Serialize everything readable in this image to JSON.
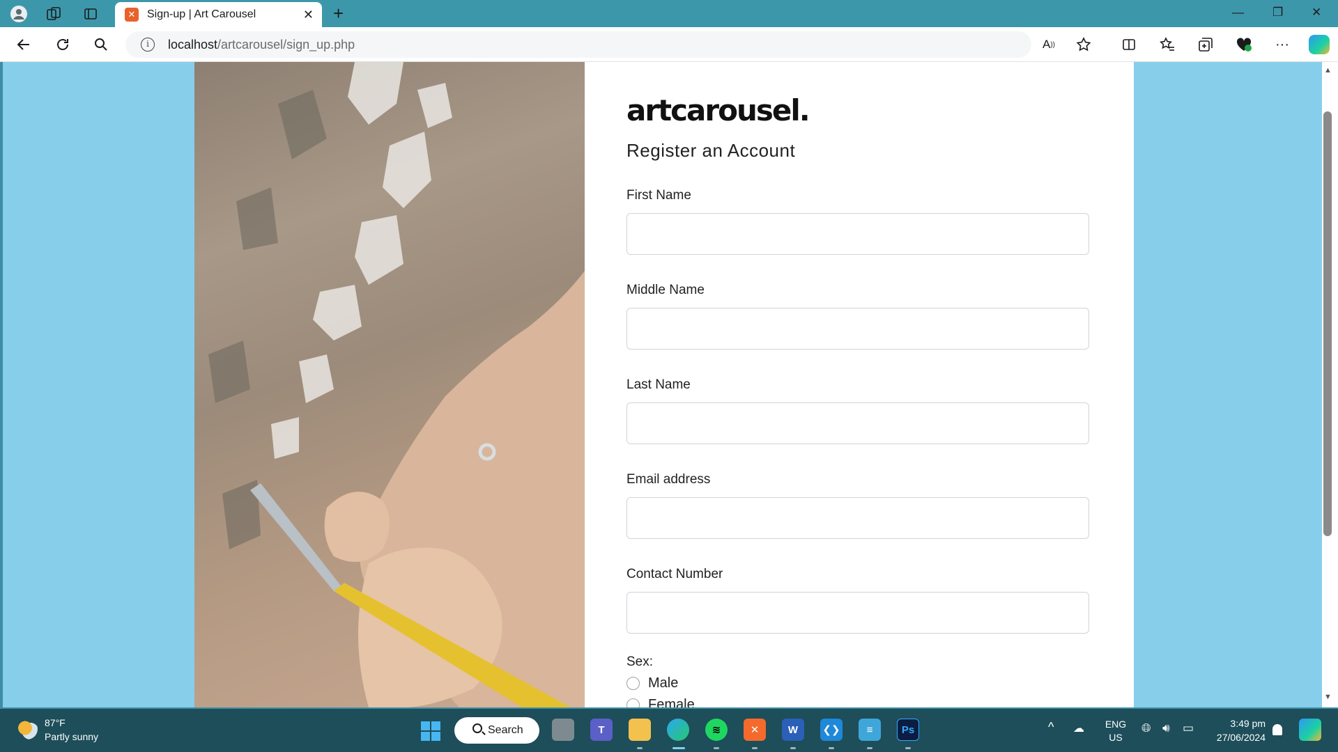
{
  "browser": {
    "tab_title": "Sign-up | Art Carousel",
    "tab_favicon": "xampp-icon",
    "url_host": "localhost",
    "url_path": "/artcarousel/sign_up.php"
  },
  "page": {
    "logo_text": "artcarousel.",
    "heading": "Register an Account",
    "fields": [
      {
        "label": "First Name",
        "value": ""
      },
      {
        "label": "Middle Name",
        "value": ""
      },
      {
        "label": "Last Name",
        "value": ""
      },
      {
        "label": "Email address",
        "value": ""
      },
      {
        "label": "Contact Number",
        "value": ""
      }
    ],
    "sex_label": "Sex:",
    "sex_options": [
      "Male",
      "Female"
    ]
  },
  "taskbar": {
    "weather_temp": "87°F",
    "weather_desc": "Partly sunny",
    "search_label": "Search",
    "lang_top": "ENG",
    "lang_bottom": "US",
    "time": "3:49 pm",
    "date": "27/06/2024"
  },
  "colors": {
    "page_background": "#87ceeb",
    "titlebar": "#3d97ab",
    "taskbar": "#1d4e5a"
  }
}
